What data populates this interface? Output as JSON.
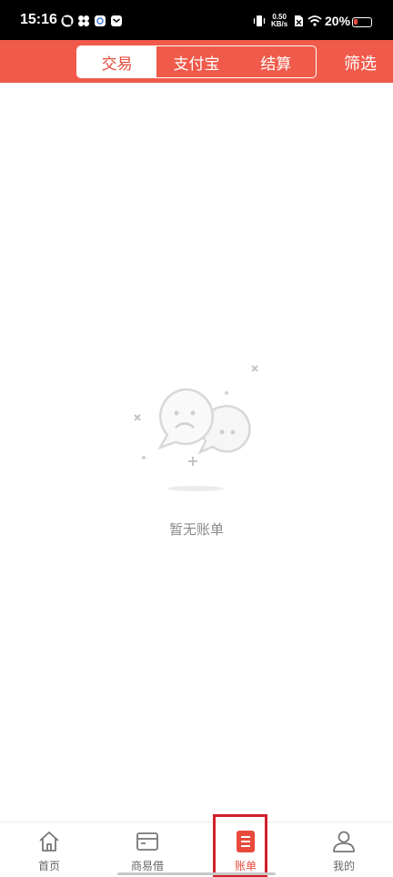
{
  "status_bar": {
    "time": "15:16",
    "net_speed_value": "0.50",
    "net_speed_unit": "KB/s",
    "battery_percent": "20%"
  },
  "header": {
    "tabs": [
      {
        "label": "交易",
        "active": true
      },
      {
        "label": "支付宝",
        "active": false
      },
      {
        "label": "结算",
        "active": false
      }
    ],
    "filter_label": "筛选"
  },
  "empty_state": {
    "text": "暂无账单",
    "icon": "sad-chat-bubbles-icon"
  },
  "bottom_nav": {
    "items": [
      {
        "label": "首页",
        "icon": "home-icon",
        "active": false
      },
      {
        "label": "商易借",
        "icon": "card-icon",
        "active": false
      },
      {
        "label": "账单",
        "icon": "bill-icon",
        "active": true
      },
      {
        "label": "我的",
        "icon": "user-icon",
        "active": false
      }
    ]
  },
  "colors": {
    "brand": "#f05a4a",
    "active_text": "#e84b3c",
    "highlight": "#d0202a"
  }
}
